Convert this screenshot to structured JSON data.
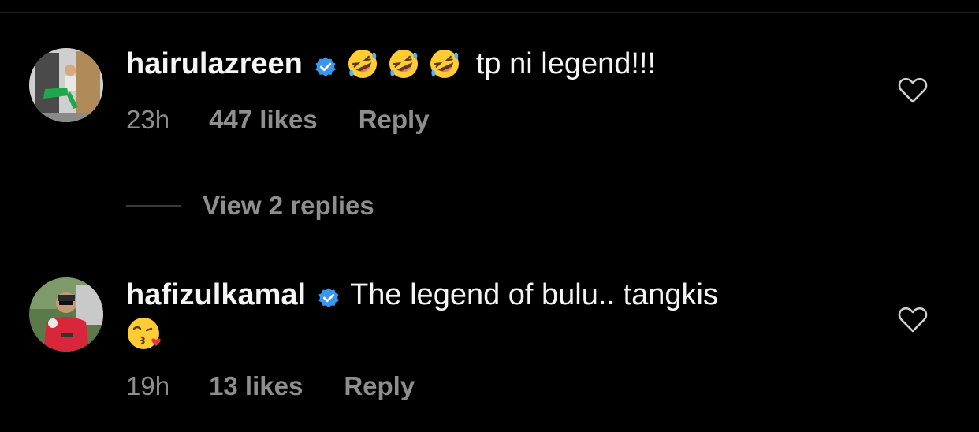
{
  "comments": [
    {
      "username": "hairulazreen",
      "text": "tp ni legend!!!",
      "emoji_prefix": [
        "rolling-on-floor-laughing",
        "rolling-on-floor-laughing",
        "rolling-on-floor-laughing"
      ],
      "time": "23h",
      "likes": "447 likes",
      "reply_label": "Reply",
      "view_replies": "View 2 replies"
    },
    {
      "username": "hafizulkamal",
      "text": "The legend of bulu.. tangkis",
      "emoji_suffix": [
        "face-blowing-a-kiss"
      ],
      "time": "19h",
      "likes": "13 likes",
      "reply_label": "Reply"
    }
  ],
  "colors": {
    "background": "#000000",
    "primary_text": "#f5f5f5",
    "secondary_text": "#8e8e8e",
    "verified_badge": "#3897f0",
    "emoji_yellow": "#ffcc33"
  }
}
